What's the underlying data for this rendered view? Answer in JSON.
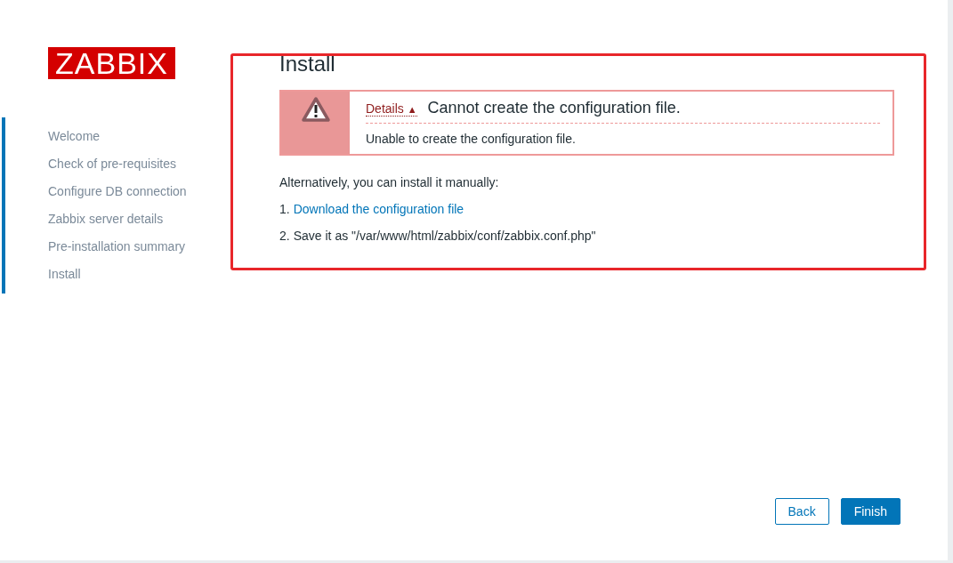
{
  "logo": {
    "text": "ZABBIX"
  },
  "steps": [
    {
      "label": "Welcome"
    },
    {
      "label": "Check of pre-requisites"
    },
    {
      "label": "Configure DB connection"
    },
    {
      "label": "Zabbix server details"
    },
    {
      "label": "Pre-installation summary"
    },
    {
      "label": "Install"
    }
  ],
  "title": "Install",
  "message": {
    "kind": "error",
    "details_link": "Details",
    "toggle": "▲",
    "summary": "Cannot create the configuration file.",
    "details": "Unable to create the configuration file."
  },
  "intro": "Alternatively, you can install it manually:",
  "instructions": [
    {
      "number": "1.",
      "text": "Download the configuration file",
      "kind": "link"
    },
    {
      "number": "2.",
      "text": "Save it as \"/var/www/html/zabbix/conf/zabbix.conf.php\"",
      "kind": "text"
    }
  ],
  "buttons": [
    {
      "label": "Back",
      "kind": "secondary"
    },
    {
      "label": "Finish",
      "kind": "primary"
    }
  ]
}
